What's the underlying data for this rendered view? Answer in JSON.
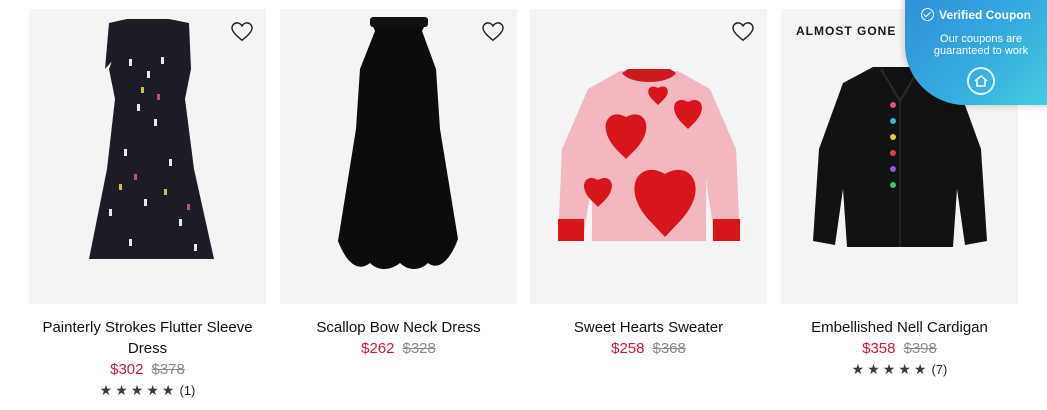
{
  "products": [
    {
      "title": "Painterly Strokes Flutter Sleeve Dress",
      "sale_price": "$302",
      "original_price": "$378",
      "rating": {
        "stars": "★★★★★",
        "count": "(1)"
      },
      "badge": ""
    },
    {
      "title": "Scallop Bow Neck Dress",
      "sale_price": "$262",
      "original_price": "$328",
      "badge": ""
    },
    {
      "title": "Sweet Hearts Sweater",
      "sale_price": "$258",
      "original_price": "$368",
      "badge": ""
    },
    {
      "title": "Embellished Nell Cardigan",
      "sale_price": "$358",
      "original_price": "$398",
      "rating": {
        "stars": "★★★★★",
        "count": "(7)"
      },
      "badge": "ALMOST GONE"
    }
  ],
  "coupon_widget": {
    "title": "Verified Coupon",
    "subtitle": "Our coupons are guaranteed to work"
  },
  "colors": {
    "sale": "#d1163e",
    "original": "#8a8a8a",
    "card_bg": "#f4f4f4",
    "coupon": "#35a9df"
  }
}
